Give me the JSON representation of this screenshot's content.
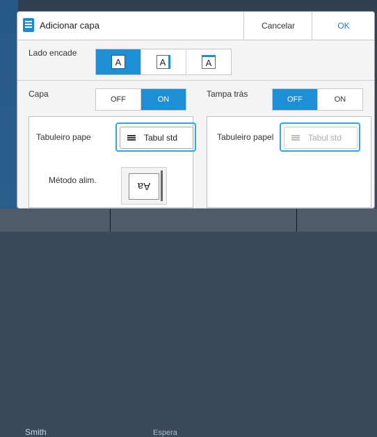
{
  "dialog": {
    "title": "Adicionar capa",
    "cancel_label": "Cancelar",
    "ok_label": "OK"
  },
  "binding_side": {
    "label": "Lado encade",
    "options": [
      "A",
      "A",
      "A"
    ],
    "selected_index": 0
  },
  "front_cover": {
    "label": "Capa",
    "off_label": "OFF",
    "on_label": "ON",
    "selected": "ON",
    "tray_label": "Tabuleiro pape",
    "tray_value": "Tabul std",
    "feed_label": "Método alim.",
    "feed_glyph": "Aa"
  },
  "back_cover": {
    "label": "Tampa trás",
    "off_label": "OFF",
    "on_label": "ON",
    "selected": "OFF",
    "tray_label": "Tabuleiro papel",
    "tray_value": "Tabul std",
    "tray_enabled": false
  },
  "background": {
    "user": "Smith",
    "status": "Espera"
  },
  "colors": {
    "accent": "#1e8fd6",
    "highlight": "#31a6e6"
  }
}
